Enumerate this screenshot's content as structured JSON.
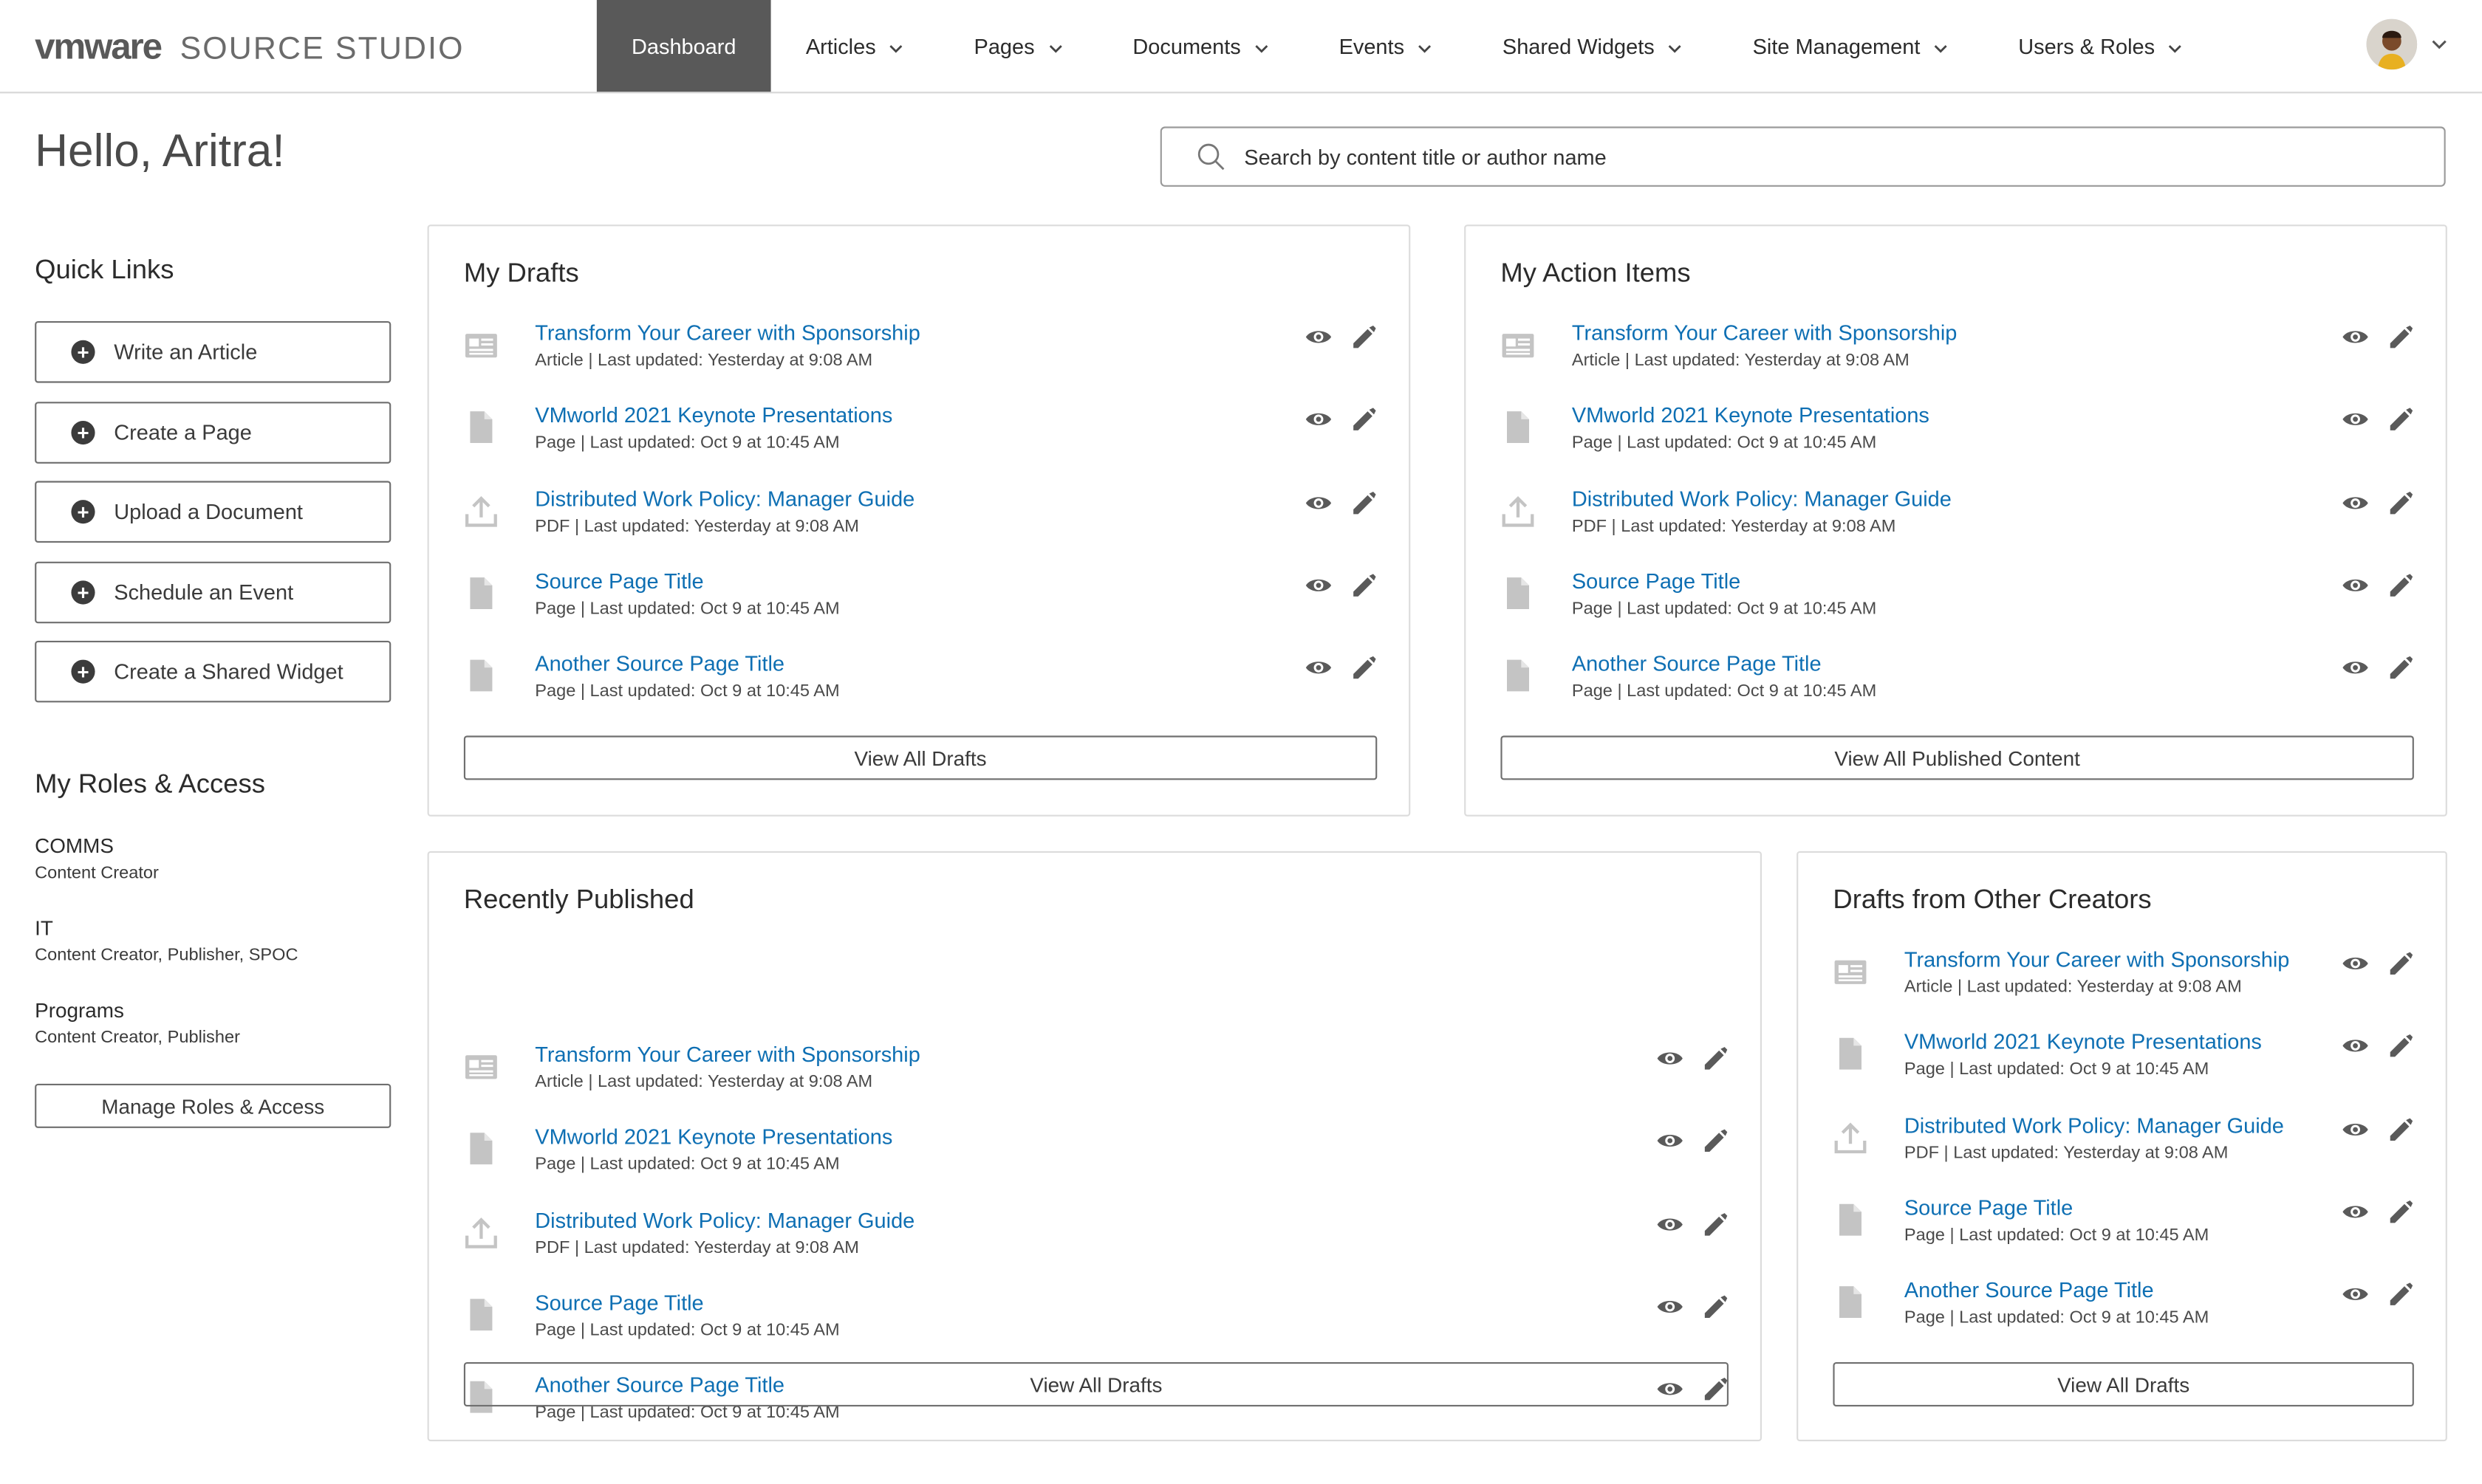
{
  "brand": {
    "logo": "vmware",
    "product": "SOURCE STUDIO"
  },
  "nav": [
    {
      "label": "Dashboard",
      "active": true
    },
    {
      "label": "Articles"
    },
    {
      "label": "Pages"
    },
    {
      "label": "Documents"
    },
    {
      "label": "Events"
    },
    {
      "label": "Shared Widgets"
    },
    {
      "label": "Site Management"
    },
    {
      "label": "Users & Roles"
    }
  ],
  "greeting": "Hello, Aritra!",
  "search": {
    "placeholder": "Search by content title or author name"
  },
  "quick_links": {
    "title": "Quick Links",
    "items": [
      {
        "label": "Write an Article"
      },
      {
        "label": "Create a Page"
      },
      {
        "label": "Upload a Document"
      },
      {
        "label": "Schedule an Event"
      },
      {
        "label": "Create a Shared Widget"
      }
    ]
  },
  "roles": {
    "title": "My Roles & Access",
    "items": [
      {
        "dept": "COMMS",
        "perm": "Content Creator"
      },
      {
        "dept": "IT",
        "perm": "Content Creator, Publisher, SPOC"
      },
      {
        "dept": "Programs",
        "perm": "Content Creator, Publisher"
      }
    ],
    "manage_label": "Manage Roles & Access"
  },
  "content_items": [
    {
      "icon": "article-icon",
      "title": "Transform Your Career with Sponsorship",
      "meta": "Article | Last updated: Yesterday at 9:08 AM"
    },
    {
      "icon": "page-icon",
      "title": "VMworld 2021 Keynote Presentations",
      "meta": "Page | Last updated: Oct 9 at 10:45 AM"
    },
    {
      "icon": "upload-icon",
      "title": "Distributed Work Policy: Manager Guide",
      "meta": "PDF | Last updated: Yesterday at 9:08 AM"
    },
    {
      "icon": "page-icon",
      "title": "Source Page Title",
      "meta": "Page | Last updated: Oct 9 at 10:45 AM"
    },
    {
      "icon": "page-icon",
      "title": "Another Source Page Title",
      "meta": "Page | Last updated: Oct 9 at 10:45 AM"
    }
  ],
  "panels": {
    "my_drafts": {
      "title": "My Drafts",
      "button": "View All Drafts"
    },
    "my_action_items": {
      "title": "My Action Items",
      "button": "View All Published Content"
    },
    "recently_published": {
      "title": "Recently Published",
      "button": "View All Drafts"
    },
    "drafts_other": {
      "title": "Drafts from Other Creators",
      "button": "View All Drafts"
    }
  },
  "colors": {
    "link": "#0e6fb3",
    "nav_active": "#595959",
    "icon_gray": "#c4c4c4",
    "action_gray": "#5a5a5a"
  }
}
